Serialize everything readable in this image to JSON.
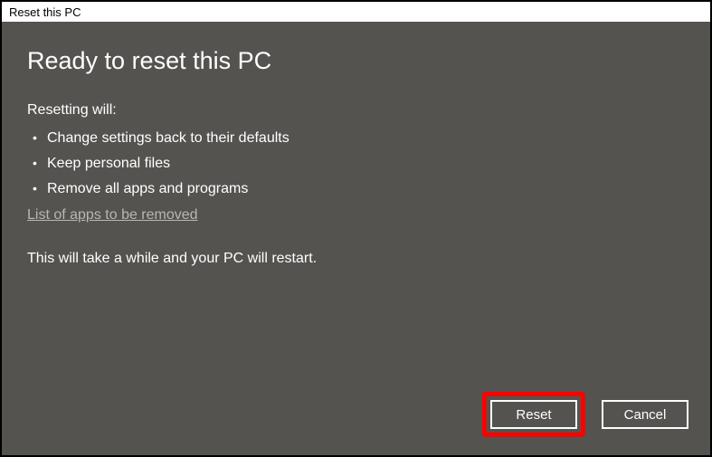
{
  "window": {
    "title": "Reset this PC"
  },
  "main": {
    "heading": "Ready to reset this PC",
    "subheading": "Resetting will:",
    "bullets": [
      "Change settings back to their defaults",
      "Keep personal files",
      "Remove all apps and programs"
    ],
    "link": "List of apps to be removed",
    "note": "This will take a while and your PC will restart."
  },
  "buttons": {
    "reset": "Reset",
    "cancel": "Cancel"
  }
}
